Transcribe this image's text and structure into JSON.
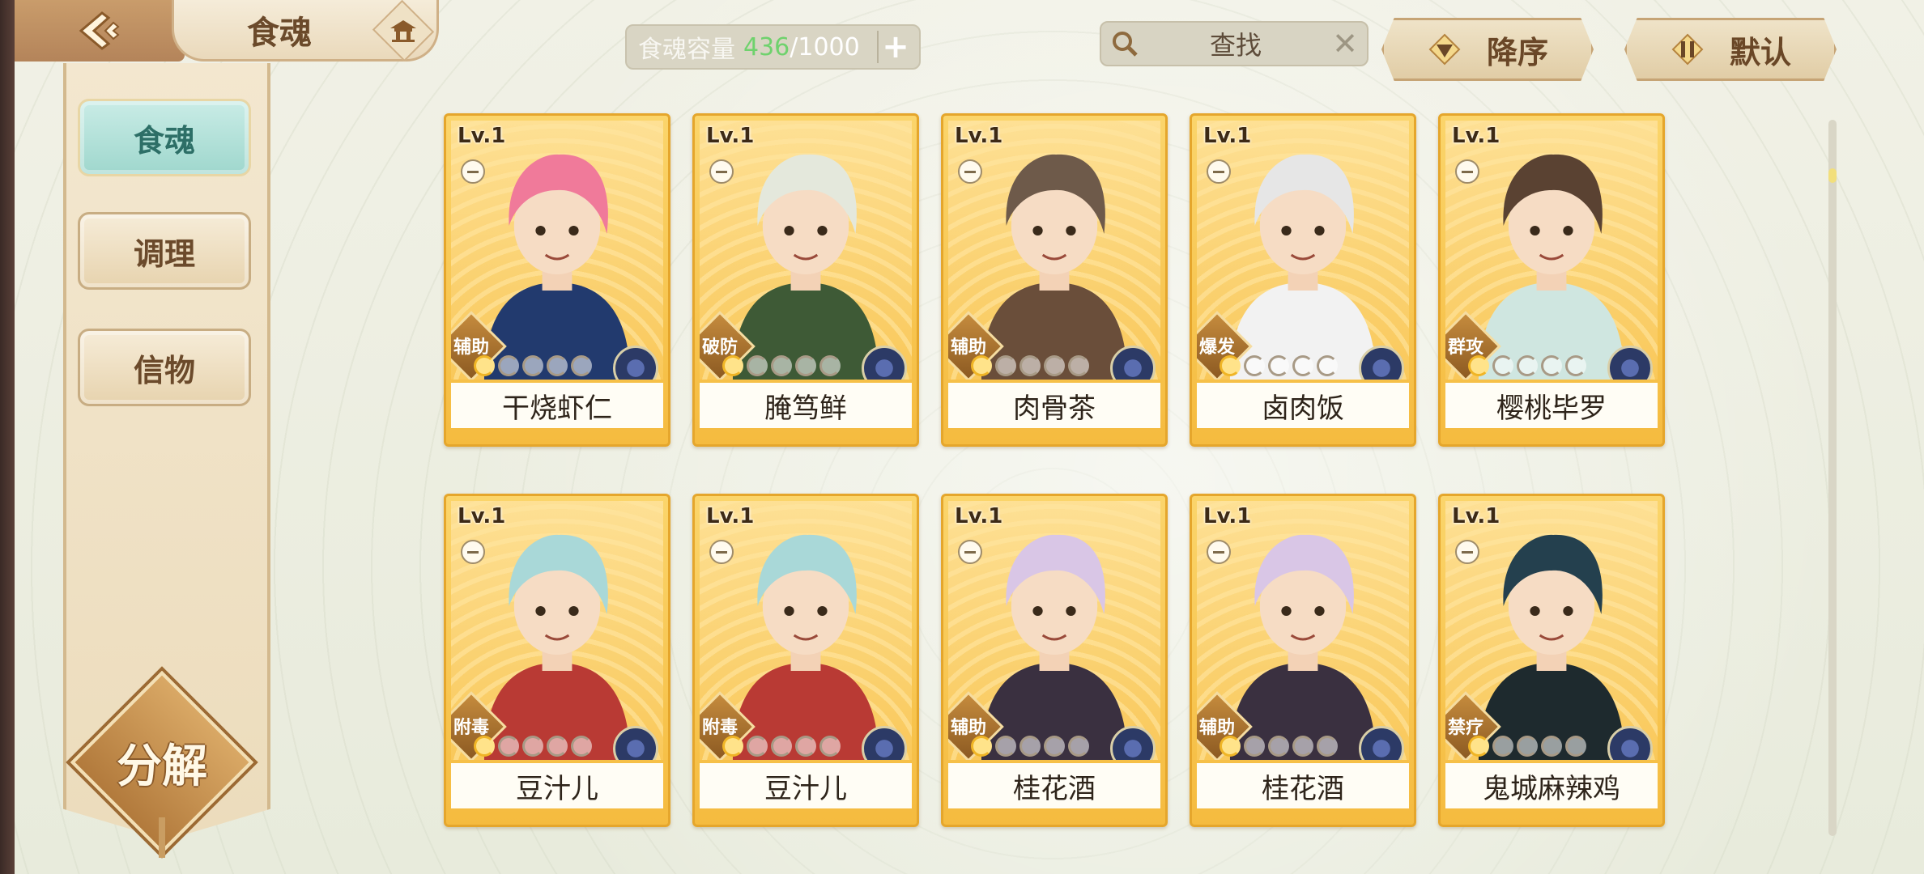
{
  "header": {
    "title": "食魂",
    "capacity": {
      "label": "食魂容量",
      "current": "436",
      "max": "/1000",
      "plus": "+"
    },
    "search": {
      "label": "查找",
      "clear": "✕"
    },
    "sort_button": "降序",
    "filter_button": "默认"
  },
  "sidebar": {
    "tabs": [
      {
        "label": "食魂",
        "active": true
      },
      {
        "label": "调理"
      },
      {
        "label": "信物"
      }
    ],
    "decompose": "分解"
  },
  "cards": [
    {
      "level": "Lv.1",
      "role": "辅助",
      "name": "干烧虾仁",
      "stars": 1,
      "hair": "#f07a9a",
      "outfit": "#223a6e"
    },
    {
      "level": "Lv.1",
      "role": "破防",
      "name": "腌笃鲜",
      "stars": 1,
      "hair": "#e4e8dc",
      "outfit": "#3e5a36"
    },
    {
      "level": "Lv.1",
      "role": "辅助",
      "name": "肉骨茶",
      "stars": 1,
      "hair": "#6e5a4a",
      "outfit": "#6a4e3a"
    },
    {
      "level": "Lv.1",
      "role": "爆发",
      "name": "卤肉饭",
      "stars": 1,
      "hair": "#e6e6e6",
      "outfit": "#f2f2f2"
    },
    {
      "level": "Lv.1",
      "role": "群攻",
      "name": "樱桃毕罗",
      "stars": 1,
      "hair": "#5a4232",
      "outfit": "#cfe6e0"
    },
    {
      "level": "Lv.1",
      "role": "附毒",
      "name": "豆汁儿",
      "stars": 1,
      "hair": "#a9d8d8",
      "outfit": "#b93a34"
    },
    {
      "level": "Lv.1",
      "role": "附毒",
      "name": "豆汁儿",
      "stars": 1,
      "hair": "#a9d8d8",
      "outfit": "#b93a34"
    },
    {
      "level": "Lv.1",
      "role": "辅助",
      "name": "桂花酒",
      "stars": 1,
      "hair": "#d9c6e6",
      "outfit": "#3a3040"
    },
    {
      "level": "Lv.1",
      "role": "辅助",
      "name": "桂花酒",
      "stars": 1,
      "hair": "#d9c6e6",
      "outfit": "#3a3040"
    },
    {
      "level": "Lv.1",
      "role": "禁疗",
      "name": "鬼城麻辣鸡",
      "stars": 1,
      "hair": "#24404e",
      "outfit": "#1e2a2e"
    }
  ],
  "colors": {
    "capacity_current": "#6fd26d",
    "active_tab": "#9fd7cd",
    "card_frame": "#f5bb3f"
  },
  "icons": [
    "back-icon",
    "home-icon",
    "search-icon",
    "close-icon",
    "sort-desc-icon",
    "filter-icon",
    "lock-icon",
    "element-icon"
  ]
}
